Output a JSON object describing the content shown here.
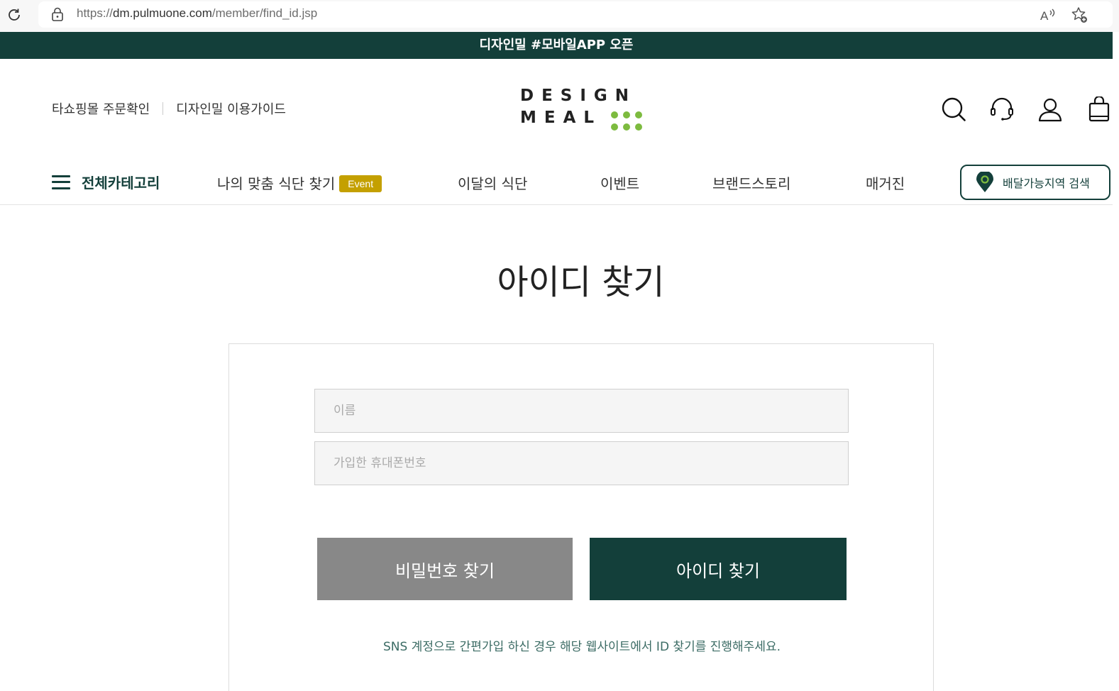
{
  "browser": {
    "url_prefix": "https://",
    "url_domain": "dm.pulmuone.com",
    "url_path": "/member/find_id.jsp"
  },
  "banner": {
    "text": "디자인밀 #모바일APP 오픈"
  },
  "header": {
    "util_links": [
      "타쇼핑몰 주문확인",
      "디자인밀 이용가이드"
    ],
    "logo": {
      "line1": "DESIGN",
      "line2": "MEAL",
      "dot_color": "#7dbb3f"
    },
    "icons": [
      "search-icon",
      "headset-icon",
      "user-icon",
      "shopping-bag-icon"
    ]
  },
  "nav": {
    "all_categories": "전체카테고리",
    "items": [
      "나의 맞춤 식단 찾기",
      "이달의 식단",
      "이벤트",
      "브랜드스토리",
      "매거진"
    ],
    "event_badge": "Event",
    "delivery_button": "배달가능지역 검색"
  },
  "page": {
    "title": "아이디 찾기",
    "name_placeholder": "이름",
    "phone_placeholder": "가입한 휴대폰번호",
    "find_password_button": "비밀번호 찾기",
    "find_id_button": "아이디 찾기",
    "sns_note": "SNS 계정으로 간편가입 하신 경우 해당 웹사이트에서 ID 찾기를 진행해주세요."
  },
  "colors": {
    "brand_dark": "#133f3a",
    "badge": "#c4a000",
    "button_gray": "#888888"
  }
}
